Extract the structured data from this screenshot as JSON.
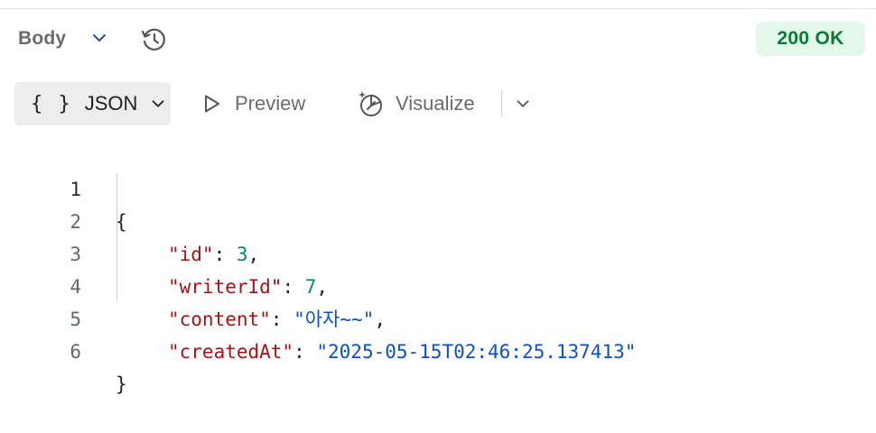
{
  "header": {
    "body_label": "Body",
    "status": "200 OK",
    "status_color": "#0b7a35",
    "status_bg": "#e3f8ea"
  },
  "toolbar": {
    "json_braces": "{ }",
    "json_label": "JSON",
    "preview_label": "Preview",
    "visualize_label": "Visualize"
  },
  "code": {
    "line_numbers": [
      "1",
      "2",
      "3",
      "4",
      "5",
      "6"
    ],
    "open_brace": "{",
    "close_brace": "}",
    "fields": [
      {
        "key": "\"id\"",
        "colon": ": ",
        "value": "3",
        "comma": ","
      },
      {
        "key": "\"writerId\"",
        "colon": ": ",
        "value": "7",
        "comma": ","
      },
      {
        "key": "\"content\"",
        "colon": ": ",
        "value": "\"아자~~\"",
        "comma": ","
      },
      {
        "key": "\"createdAt\"",
        "colon": ": ",
        "value": "\"2025-05-15T02:46:25.137413\"",
        "comma": ""
      }
    ]
  },
  "icons": {
    "body_dropdown": "chevron-down-icon",
    "history": "history-icon",
    "json_dropdown": "chevron-down-icon",
    "preview": "play-icon",
    "visualize": "visualize-icon",
    "visualize_dropdown": "chevron-down-icon"
  }
}
